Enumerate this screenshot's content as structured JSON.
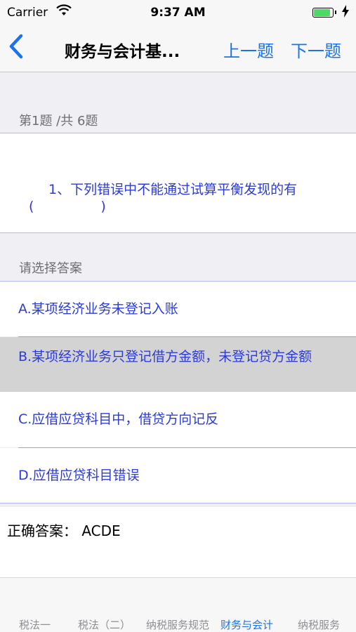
{
  "status_bar": {
    "carrier": "Carrier",
    "time": "9:37 AM"
  },
  "nav": {
    "title": "财务与会计基...",
    "prev_label": "上一题",
    "next_label": "下一题"
  },
  "progress": "第1题 /共 6题",
  "question": {
    "line1": "1、下列错误中不能通过试算平衡发现的有",
    "line2": "(　　　　　)"
  },
  "answer_section_title": "请选择答案",
  "options": [
    {
      "text": "A.某项经济业务未登记入账",
      "selected": false
    },
    {
      "text": "B.某项经济业务只登记借方金额，未登记贷方金额",
      "selected": true
    },
    {
      "text": "C.应借应贷科目中，借贷方向记反",
      "selected": false
    },
    {
      "text": "D.应借应贷科目错误",
      "selected": false
    }
  ],
  "correct_answer": "正确答案：  ACDE",
  "tabs": [
    {
      "label": "税法一"
    },
    {
      "label": "税法（二）"
    },
    {
      "label": "纳税服务规范"
    },
    {
      "label": "财务与会计",
      "active": true
    },
    {
      "label": "纳税服务"
    }
  ],
  "colors": {
    "accent": "#1a73e8",
    "option_text": "#2d3bd6",
    "selected_bg": "#d3d3d3"
  }
}
